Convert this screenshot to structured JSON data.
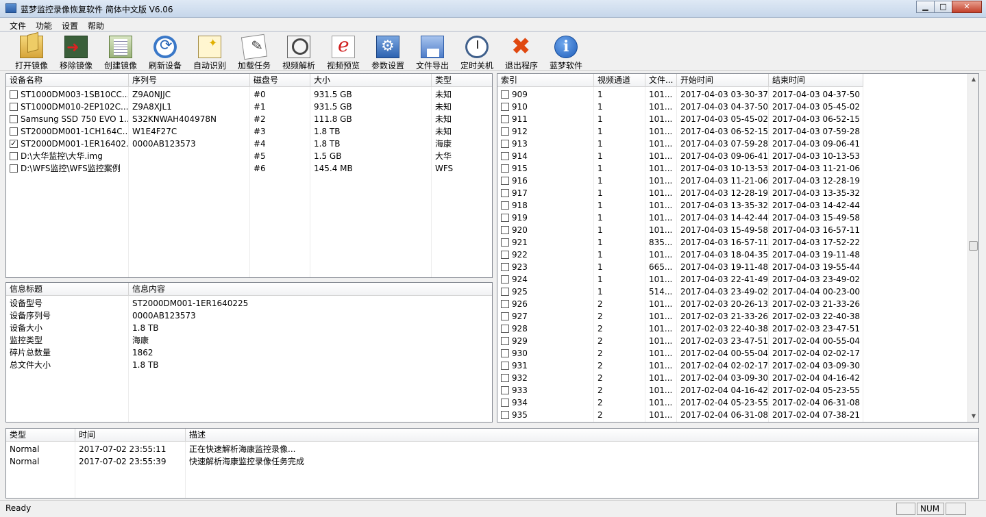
{
  "window": {
    "title": "蓝梦监控录像恢复软件  简体中文版  V6.06"
  },
  "menu": [
    "文件",
    "功能",
    "设置",
    "帮助"
  ],
  "toolbar": [
    {
      "label": "打开镜像",
      "icon": "open-image-icon"
    },
    {
      "label": "移除镜像",
      "icon": "remove-image-icon"
    },
    {
      "label": "创建镜像",
      "icon": "create-image-icon"
    },
    {
      "label": "刷新设备",
      "icon": "refresh-device-icon"
    },
    {
      "label": "自动识别",
      "icon": "auto-detect-icon"
    },
    {
      "label": "加载任务",
      "icon": "load-task-icon"
    },
    {
      "label": "视频解析",
      "icon": "video-parse-icon"
    },
    {
      "label": "视频预览",
      "icon": "video-preview-icon"
    },
    {
      "label": "参数设置",
      "icon": "settings-icon"
    },
    {
      "label": "文件导出",
      "icon": "file-export-icon"
    },
    {
      "label": "定时关机",
      "icon": "timer-shutdown-icon"
    },
    {
      "label": "退出程序",
      "icon": "exit-icon"
    },
    {
      "label": "蓝梦软件",
      "icon": "about-icon"
    }
  ],
  "devices": {
    "columns": [
      "设备名称",
      "序列号",
      "磁盘号",
      "大小",
      "类型"
    ],
    "rows": [
      {
        "name": "ST1000DM003-1SB10CC...",
        "serial": "Z9A0NJJC",
        "disk": "#0",
        "size": "931.5 GB",
        "type": "未知",
        "checked": false
      },
      {
        "name": "ST1000DM010-2EP102C...",
        "serial": "Z9A8XJL1",
        "disk": "#1",
        "size": "931.5 GB",
        "type": "未知",
        "checked": false
      },
      {
        "name": "Samsung SSD 750 EVO 1...",
        "serial": "S32KNWAH404978N",
        "disk": "#2",
        "size": "111.8 GB",
        "type": "未知",
        "checked": false
      },
      {
        "name": "ST2000DM001-1CH164C...",
        "serial": "W1E4F27C",
        "disk": "#3",
        "size": "1.8 TB",
        "type": "未知",
        "checked": false
      },
      {
        "name": "ST2000DM001-1ER16402...",
        "serial": "0000AB123573",
        "disk": "#4",
        "size": "1.8 TB",
        "type": "海康",
        "checked": true
      },
      {
        "name": "D:\\大华监控\\大华.img",
        "serial": "",
        "disk": "#5",
        "size": "1.5 GB",
        "type": "大华",
        "checked": false
      },
      {
        "name": "D:\\WFS监控\\WFS监控案例",
        "serial": "",
        "disk": "#6",
        "size": "145.4 MB",
        "type": "WFS",
        "checked": false
      }
    ]
  },
  "info": {
    "columns": [
      "信息标题",
      "信息内容"
    ],
    "rows": [
      {
        "k": "设备型号",
        "v": "ST2000DM001-1ER1640225"
      },
      {
        "k": "设备序列号",
        "v": "0000AB123573"
      },
      {
        "k": "设备大小",
        "v": "1.8 TB"
      },
      {
        "k": "监控类型",
        "v": "海康"
      },
      {
        "k": "碎片总数量",
        "v": "1862"
      },
      {
        "k": "总文件大小",
        "v": "1.8 TB"
      }
    ]
  },
  "videos": {
    "columns": [
      "索引",
      "视频通道",
      "文件...",
      "开始时间",
      "结束时间"
    ],
    "rows": [
      {
        "idx": "909",
        "ch": "1",
        "size": "101...",
        "start": "2017-04-03 03-30-37",
        "end": "2017-04-03 04-37-50"
      },
      {
        "idx": "910",
        "ch": "1",
        "size": "101...",
        "start": "2017-04-03 04-37-50",
        "end": "2017-04-03 05-45-02"
      },
      {
        "idx": "911",
        "ch": "1",
        "size": "101...",
        "start": "2017-04-03 05-45-02",
        "end": "2017-04-03 06-52-15"
      },
      {
        "idx": "912",
        "ch": "1",
        "size": "101...",
        "start": "2017-04-03 06-52-15",
        "end": "2017-04-03 07-59-28"
      },
      {
        "idx": "913",
        "ch": "1",
        "size": "101...",
        "start": "2017-04-03 07-59-28",
        "end": "2017-04-03 09-06-41"
      },
      {
        "idx": "914",
        "ch": "1",
        "size": "101...",
        "start": "2017-04-03 09-06-41",
        "end": "2017-04-03 10-13-53"
      },
      {
        "idx": "915",
        "ch": "1",
        "size": "101...",
        "start": "2017-04-03 10-13-53",
        "end": "2017-04-03 11-21-06"
      },
      {
        "idx": "916",
        "ch": "1",
        "size": "101...",
        "start": "2017-04-03 11-21-06",
        "end": "2017-04-03 12-28-19"
      },
      {
        "idx": "917",
        "ch": "1",
        "size": "101...",
        "start": "2017-04-03 12-28-19",
        "end": "2017-04-03 13-35-32"
      },
      {
        "idx": "918",
        "ch": "1",
        "size": "101...",
        "start": "2017-04-03 13-35-32",
        "end": "2017-04-03 14-42-44"
      },
      {
        "idx": "919",
        "ch": "1",
        "size": "101...",
        "start": "2017-04-03 14-42-44",
        "end": "2017-04-03 15-49-58"
      },
      {
        "idx": "920",
        "ch": "1",
        "size": "101...",
        "start": "2017-04-03 15-49-58",
        "end": "2017-04-03 16-57-11"
      },
      {
        "idx": "921",
        "ch": "1",
        "size": "835...",
        "start": "2017-04-03 16-57-11",
        "end": "2017-04-03 17-52-22"
      },
      {
        "idx": "922",
        "ch": "1",
        "size": "101...",
        "start": "2017-04-03 18-04-35",
        "end": "2017-04-03 19-11-48"
      },
      {
        "idx": "923",
        "ch": "1",
        "size": "665...",
        "start": "2017-04-03 19-11-48",
        "end": "2017-04-03 19-55-44"
      },
      {
        "idx": "924",
        "ch": "1",
        "size": "101...",
        "start": "2017-04-03 22-41-49",
        "end": "2017-04-03 23-49-02"
      },
      {
        "idx": "925",
        "ch": "1",
        "size": "514...",
        "start": "2017-04-03 23-49-02",
        "end": "2017-04-04 00-23-00"
      },
      {
        "idx": "926",
        "ch": "2",
        "size": "101...",
        "start": "2017-02-03 20-26-13",
        "end": "2017-02-03 21-33-26"
      },
      {
        "idx": "927",
        "ch": "2",
        "size": "101...",
        "start": "2017-02-03 21-33-26",
        "end": "2017-02-03 22-40-38"
      },
      {
        "idx": "928",
        "ch": "2",
        "size": "101...",
        "start": "2017-02-03 22-40-38",
        "end": "2017-02-03 23-47-51"
      },
      {
        "idx": "929",
        "ch": "2",
        "size": "101...",
        "start": "2017-02-03 23-47-51",
        "end": "2017-02-04 00-55-04"
      },
      {
        "idx": "930",
        "ch": "2",
        "size": "101...",
        "start": "2017-02-04 00-55-04",
        "end": "2017-02-04 02-02-17"
      },
      {
        "idx": "931",
        "ch": "2",
        "size": "101...",
        "start": "2017-02-04 02-02-17",
        "end": "2017-02-04 03-09-30"
      },
      {
        "idx": "932",
        "ch": "2",
        "size": "101...",
        "start": "2017-02-04 03-09-30",
        "end": "2017-02-04 04-16-42"
      },
      {
        "idx": "933",
        "ch": "2",
        "size": "101...",
        "start": "2017-02-04 04-16-42",
        "end": "2017-02-04 05-23-55"
      },
      {
        "idx": "934",
        "ch": "2",
        "size": "101...",
        "start": "2017-02-04 05-23-55",
        "end": "2017-02-04 06-31-08"
      },
      {
        "idx": "935",
        "ch": "2",
        "size": "101...",
        "start": "2017-02-04 06-31-08",
        "end": "2017-02-04 07-38-21"
      }
    ]
  },
  "log": {
    "columns": [
      "类型",
      "时间",
      "描述"
    ],
    "rows": [
      {
        "type": "Normal",
        "time": "2017-07-02 23:55:11",
        "desc": "正在快速解析海康监控录像..."
      },
      {
        "type": "Normal",
        "time": "2017-07-02 23:55:39",
        "desc": "快速解析海康监控录像任务完成"
      }
    ]
  },
  "status": {
    "text": "Ready",
    "num": "NUM"
  }
}
